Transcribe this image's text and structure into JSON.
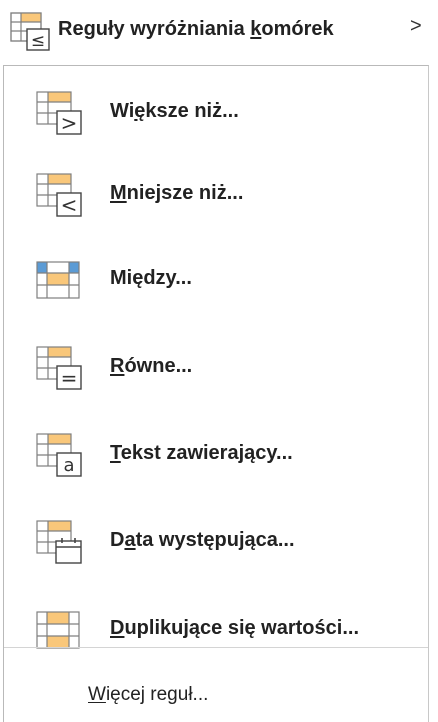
{
  "parent_menu": {
    "label_pre": "Reguły wyróżniania ",
    "label_key": "k",
    "label_post": "omórek",
    "chevron": ">",
    "icon": "highlight-cells-rules-icon"
  },
  "items": [
    {
      "pre": "Wi",
      "key": "ę",
      "post": "ksze niż...",
      "icon": "greater-than-icon"
    },
    {
      "pre": "",
      "key": "M",
      "post": "niejsze niż...",
      "icon": "less-than-icon"
    },
    {
      "pre": "Między",
      "key": "",
      "post": "...",
      "icon": "between-icon"
    },
    {
      "pre": "",
      "key": "R",
      "post": "ówne...",
      "icon": "equal-to-icon"
    },
    {
      "pre": "",
      "key": "T",
      "post": "ekst zawierający...",
      "icon": "text-contains-icon"
    },
    {
      "pre": "D",
      "key": "a",
      "post": "ta występująca...",
      "icon": "date-occurring-icon"
    },
    {
      "pre": "",
      "key": "D",
      "post": "uplikujące się wartości...",
      "icon": "duplicate-values-icon"
    }
  ],
  "more_rules": {
    "pre": "",
    "key": "W",
    "post": "ięcej reguł..."
  },
  "icon_symbols": {
    "greater": ">",
    "less": "<",
    "equal": "=",
    "text": "a",
    "le": "≤"
  },
  "colors": {
    "orange": "#f9c77a",
    "blue": "#5b9bd5",
    "grid": "#7f7f7f"
  }
}
